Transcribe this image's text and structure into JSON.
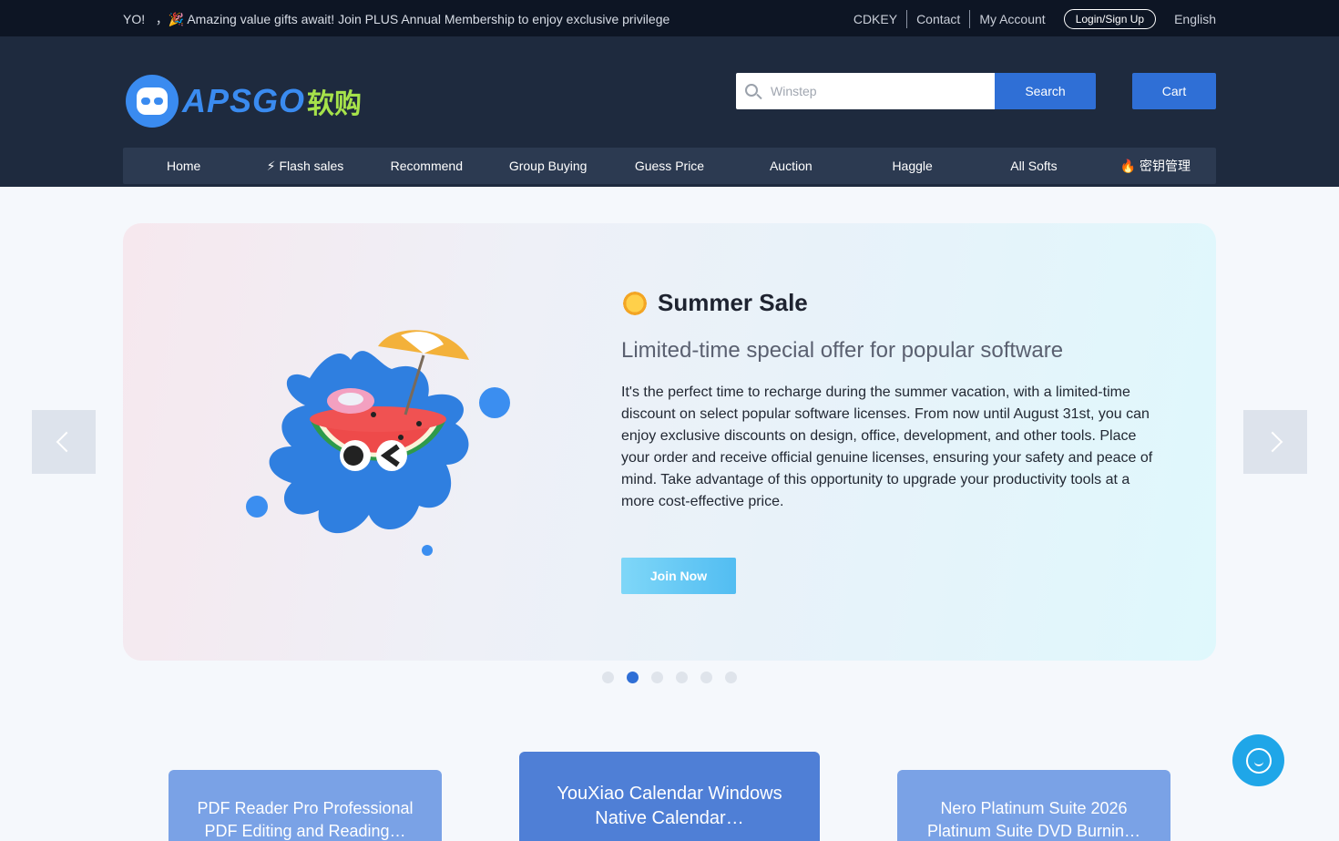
{
  "topbar": {
    "announcement": "YO!   ，🎉 Amazing value gifts await! Join PLUS Annual Membership to enjoy exclusive privileges",
    "links": [
      "CDKEY",
      "Contact",
      "My Account"
    ],
    "login_label": "Login/Sign Up",
    "language": "English"
  },
  "header": {
    "logo_text": "APSGO",
    "logo_cn": "软购",
    "search": {
      "placeholder": "Winstep",
      "button_label": "Search",
      "icon": "search-icon"
    },
    "cart_label": "Cart"
  },
  "nav": {
    "items": [
      {
        "label": "Home",
        "emoji": ""
      },
      {
        "label": "Flash sales",
        "emoji": "⚡"
      },
      {
        "label": "Recommend",
        "emoji": ""
      },
      {
        "label": "Group Buying",
        "emoji": ""
      },
      {
        "label": "Guess Price",
        "emoji": ""
      },
      {
        "label": "Auction",
        "emoji": ""
      },
      {
        "label": "Haggle",
        "emoji": ""
      },
      {
        "label": "All Softs",
        "emoji": ""
      },
      {
        "label": "密钥管理",
        "emoji": "🔥"
      }
    ]
  },
  "banner": {
    "title": "Summer Sale",
    "subtitle": "Limited-time special offer for popular software",
    "description": "It's the perfect time to recharge during the summer vacation, with a limited-time discount on select popular software licenses. From now until August 31st, you can enjoy exclusive discounts on design, office, development, and other tools. Place your order and receive official genuine licenses, ensuring your safety and peace of mind. Take advantage of this opportunity to upgrade your productivity tools at a more cost-effective price.",
    "button_label": "Join Now",
    "slide_count": 6,
    "active_slide": 2
  },
  "cards": [
    {
      "line1": "PDF Reader Pro Professional",
      "line2": "PDF Editing and Reading…"
    },
    {
      "line1": "YouXiao Calendar Windows",
      "line2": "Native Calendar…"
    },
    {
      "line1": "Nero Platinum Suite 2026",
      "line2": "Platinum Suite DVD Burnin…"
    }
  ],
  "colors": {
    "accent": "#2f6fd6",
    "header_bg": "#1e2a3e",
    "topbar_bg": "#0d1524",
    "nav_bg": "#2c3a51"
  }
}
